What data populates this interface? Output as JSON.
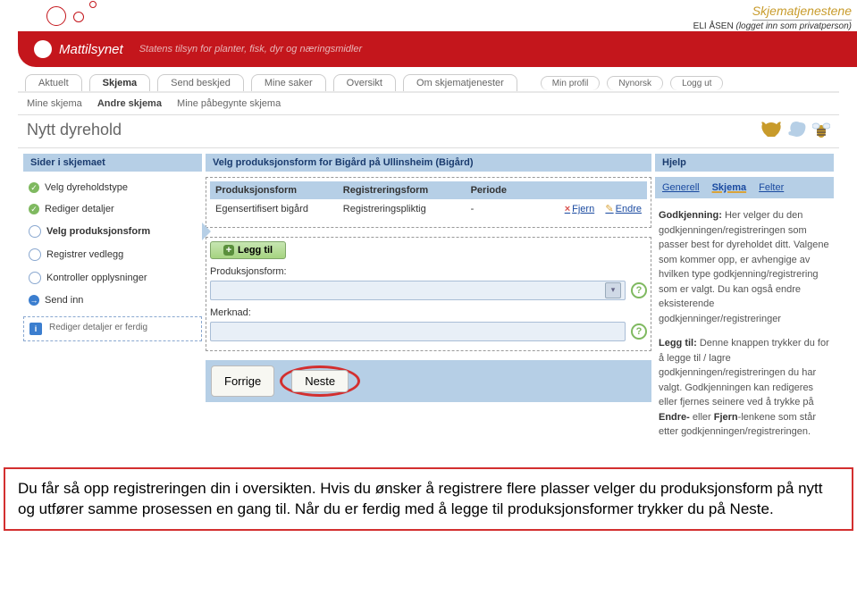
{
  "top": {
    "brand": "Skjematjenestene",
    "user_name": "ELI ÅSEN",
    "user_status": "(logget inn som privatperson)"
  },
  "header": {
    "logo": "Mattilsynet",
    "tagline": "Statens tilsyn for planter, fisk, dyr og næringsmidler"
  },
  "tabs": [
    "Aktuelt",
    "Skjema",
    "Send beskjed",
    "Mine saker",
    "Oversikt",
    "Om skjematjenester"
  ],
  "active_tab": 1,
  "pills": [
    "Min profil",
    "Nynorsk",
    "Logg ut"
  ],
  "subtabs": [
    "Mine skjema",
    "Andre skjema",
    "Mine påbegynte skjema"
  ],
  "active_subtab": 1,
  "page_title": "Nytt dyrehold",
  "left": {
    "title": "Sider i skjemaet",
    "steps": [
      {
        "label": "Velg dyreholdstype",
        "state": "done"
      },
      {
        "label": "Rediger detaljer",
        "state": "done"
      },
      {
        "label": "Velg produksjonsform",
        "state": "current"
      },
      {
        "label": "Registrer vedlegg",
        "state": "todo"
      },
      {
        "label": "Kontroller opplysninger",
        "state": "todo"
      },
      {
        "label": "Send inn",
        "state": "send"
      }
    ],
    "info": "Rediger detaljer er ferdig"
  },
  "mid": {
    "title": "Velg produksjonsform for Bigård på Ullinsheim (Bigård)",
    "table": {
      "headers": [
        "Produksjonsform",
        "Registreringsform",
        "Periode"
      ],
      "row": {
        "c1": "Egensertifisert bigård",
        "c2": "Registreringspliktig",
        "c3": "-",
        "remove": "Fjern",
        "edit": "Endre"
      }
    },
    "add_btn": "Legg til",
    "field1": "Produksjonsform:",
    "field2": "Merknad:",
    "prev_btn": "Forrige",
    "next_btn": "Neste"
  },
  "right": {
    "title": "Hjelp",
    "links": [
      "Generell",
      "Skjema",
      "Felter"
    ],
    "active_link": 1,
    "p1_b": "Godkjenning:",
    "p1": " Her velger du den godkjenningen/registreringen som passer best for dyreholdet ditt. Valgene som kommer opp, er avhengige av hvilken type godkjenning/registrering som er valgt. Du kan også endre eksisterende godkjenninger/registreringer",
    "p2_b": "Legg til:",
    "p2": " Denne knappen trykker du for å legge til / lagre godkjenningen/registreringen du har valgt. Godkjenningen kan redigeres eller fjernes seinere ved å trykke på ",
    "p2_b2": "Endre-",
    "p2_mid": " eller ",
    "p2_b3": "Fjern",
    "p2_end": "-lenkene som står etter godkjenningen/registreringen."
  },
  "note": "Du får så opp registreringen din i oversikten. Hvis du ønsker å registrere flere plasser velger du produksjonsform på nytt og utfører samme prosessen en gang til. Når du er ferdig med å legge til produksjonsformer trykker du på Neste."
}
